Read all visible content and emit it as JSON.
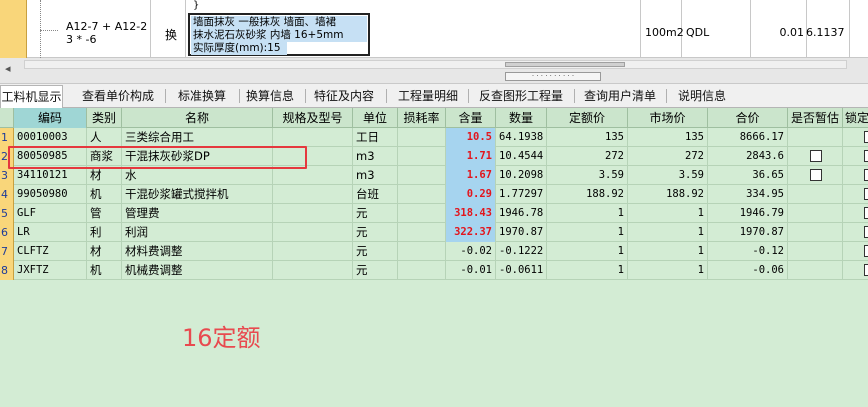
{
  "top_row": {
    "code": "A12-7 + A12-2 3 * -6",
    "kind": "换",
    "name_lines": [
      "墙面抹灰 一般抹灰 墙面、墙裙",
      "抹水泥石灰砂浆 内墙 16+5mm"
    ],
    "name_extra": "实际厚度(mm):15",
    "unit": "100m2",
    "source": "QDL",
    "quantity": "0.01",
    "price": "6.1137"
  },
  "tabs": [
    {
      "label": "工料机显示",
      "active": true
    },
    {
      "label": "查看单价构成"
    },
    {
      "label": "标准换算"
    },
    {
      "label": "换算信息"
    },
    {
      "label": "特征及内容"
    },
    {
      "label": "工程量明细"
    },
    {
      "label": "反查图形工程量"
    },
    {
      "label": "查询用户清单"
    },
    {
      "label": "说明信息"
    }
  ],
  "columns": [
    "编码",
    "类别",
    "名称",
    "规格及型号",
    "单位",
    "损耗率",
    "含量",
    "数量",
    "定额价",
    "市场价",
    "合价",
    "是否暂估",
    "锁定"
  ],
  "rows": [
    {
      "n": "1",
      "code": "00010003",
      "cat": "人",
      "name": "三类综合用工",
      "unit": "工日",
      "qty": "10.5",
      "amount": "64.1938",
      "base": "135",
      "market": "135",
      "total": "8666.17",
      "chk": false
    },
    {
      "n": "2",
      "code": "80050985",
      "cat": "商浆",
      "name": "干混抹灰砂浆DP",
      "unit": "m3",
      "qty": "1.71",
      "amount": "10.4544",
      "base": "272",
      "market": "272",
      "total": "2843.6",
      "chk": true
    },
    {
      "n": "3",
      "code": "34110121",
      "cat": "材",
      "name": "水",
      "unit": "m3",
      "qty": "1.67",
      "amount": "10.2098",
      "base": "3.59",
      "market": "3.59",
      "total": "36.65",
      "chk": true
    },
    {
      "n": "4",
      "code": "99050980",
      "cat": "机",
      "name": "干混砂浆罐式搅拌机",
      "unit": "台班",
      "qty": "0.29",
      "amount": "1.77297",
      "base": "188.92",
      "market": "188.92",
      "total": "334.95",
      "chk": false
    },
    {
      "n": "5",
      "code": "GLF",
      "cat": "管",
      "name": "管理费",
      "unit": "元",
      "qty": "318.43",
      "amount": "1946.78",
      "base": "1",
      "market": "1",
      "total": "1946.79",
      "chk": false
    },
    {
      "n": "6",
      "code": "LR",
      "cat": "利",
      "name": "利润",
      "unit": "元",
      "qty": "322.37",
      "amount": "1970.87",
      "base": "1",
      "market": "1",
      "total": "1970.87",
      "chk": false
    },
    {
      "n": "7",
      "code": "CLFTZ",
      "cat": "材",
      "name": "材料费调整",
      "unit": "元",
      "qty": "-0.02",
      "amount": "-0.1222",
      "base": "1",
      "market": "1",
      "total": "-0.12",
      "chk": false,
      "plain": true
    },
    {
      "n": "8",
      "code": "JXFTZ",
      "cat": "机",
      "name": "机械费调整",
      "unit": "元",
      "qty": "-0.01",
      "amount": "-0.0611",
      "base": "1",
      "market": "1",
      "total": "-0.06",
      "chk": false,
      "plain": true
    }
  ],
  "annotation": "16定额",
  "colors": {
    "qty_highlight": "#e2151d",
    "selection_box": "#e5383e",
    "grid_bg": "#d3ecd4"
  }
}
